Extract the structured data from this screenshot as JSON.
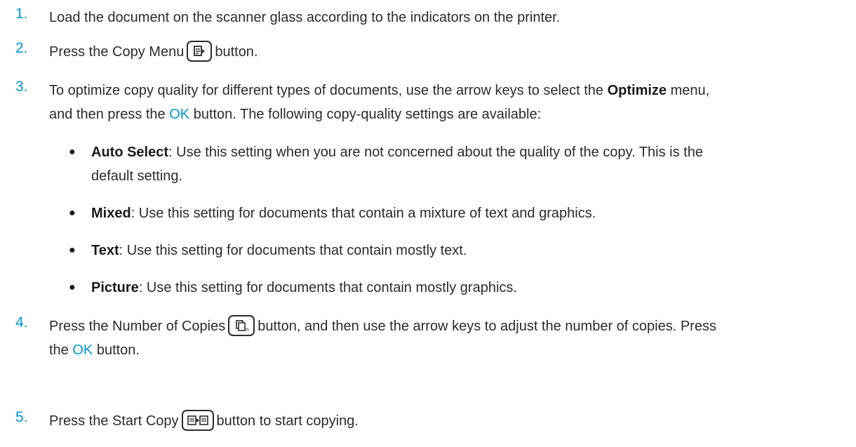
{
  "steps": [
    {
      "number": "1.",
      "text": "Load the document on the scanner glass according to the indicators on the printer."
    },
    {
      "number": "2.",
      "before": "Press the Copy Menu",
      "icon": "copy-menu-icon",
      "after": "button."
    },
    {
      "number": "3.",
      "line1_a": "To optimize copy quality for different types of documents, use the arrow keys to select the ",
      "line1_bold": "Optimize",
      "line1_b": " menu,",
      "line2_a": "and then press the ",
      "line2_ok": "OK",
      "line2_b": " button. The following copy-quality settings are available:",
      "options": [
        {
          "label": "Auto Select",
          "desc_line1": ": Use this setting when you are not concerned about the quality of the copy. This is the",
          "desc_line2": "default setting."
        },
        {
          "label": "Mixed",
          "desc_line1": ": Use this setting for documents that contain a mixture of text and graphics."
        },
        {
          "label": "Text",
          "desc_line1": ": Use this setting for documents that contain mostly text."
        },
        {
          "label": "Picture",
          "desc_line1": ": Use this setting for documents that contain mostly graphics."
        }
      ]
    },
    {
      "number": "4.",
      "before": "Press the Number of Copies",
      "icon": "number-of-copies-icon",
      "after": "button, and then use the arrow keys to adjust the number of copies. Press",
      "line2_a": "the ",
      "line2_ok": "OK",
      "line2_b": " button."
    },
    {
      "number": "5.",
      "before": "Press the Start Copy",
      "icon": "start-copy-icon",
      "after": "button to start copying."
    }
  ],
  "bullet_glyph": "●",
  "accent_color": "#0096d6"
}
